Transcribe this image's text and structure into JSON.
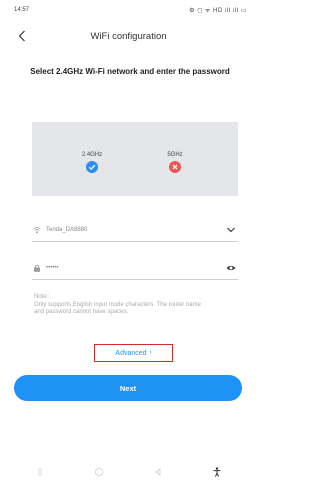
{
  "status_bar": {
    "time": "14:57",
    "icons_text": "⚙ ◻ ᯤ HD ıll ıll ▭"
  },
  "header": {
    "title": "WiFi configuration"
  },
  "instruction": "Select 2.4GHz Wi-Fi network and enter the password",
  "bands": [
    {
      "label": "2.4GHz",
      "status": "supported",
      "color": "#2b8ef5"
    },
    {
      "label": "5GHz",
      "status": "not-supported",
      "color": "#f05454"
    }
  ],
  "ssid": {
    "value": "Tenda_DA8880"
  },
  "password": {
    "value": "••••••"
  },
  "note": {
    "title": "Note：",
    "body": "Only supports English input mode characters. The router name and password cannot have spaces."
  },
  "advanced": {
    "label": "Advanced",
    "chevron": "›"
  },
  "next_button": {
    "label": "Next"
  },
  "colors": {
    "accent": "#1f93f5",
    "highlight_border": "#d8282a",
    "panel_bg": "#e4e6ea"
  }
}
